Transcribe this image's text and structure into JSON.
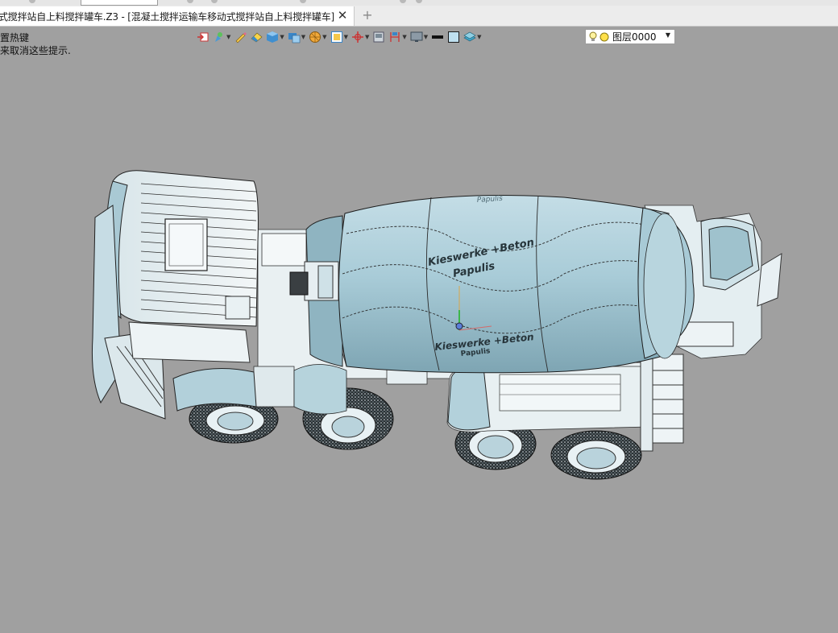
{
  "window": {
    "tab_title": "式搅拌站自上料搅拌罐车.Z3 - [混凝土搅拌运输车移动式搅拌站自上料搅拌罐车]",
    "tab_close_icon": "close-icon",
    "new_tab_icon": "plus-icon"
  },
  "hints": {
    "line1": "置热键",
    "line2": "来取消这些提示."
  },
  "toolbar": {
    "icons": [
      "insert-icon",
      "pen-icon",
      "pencil-icon",
      "eraser-icon",
      "cube-icon",
      "view-cube-icon",
      "sphere-icon",
      "zoom-window-icon",
      "axis-icon",
      "section-icon",
      "dimension-icon",
      "monitor-icon",
      "line-color-icon",
      "fill-color-icon",
      "layer-stack-icon"
    ],
    "layer_select": {
      "value": "图层0000",
      "icons": [
        "bulb-icon",
        "layer-color-icon"
      ]
    }
  },
  "model": {
    "drum_text_top": "Kieswerke +Beton",
    "drum_text_top_sub": "Papulis",
    "drum_text_bottom": "Kieswerke +Beton",
    "drum_text_bottom_sub": "Papulis",
    "drum_text_faint": "Papulis",
    "colors": {
      "body": "#a9ccd8",
      "body_dark": "#6c8f9c",
      "cab_white": "#eef3f5",
      "tire": "#2f3538",
      "background": "#a0a0a0"
    }
  }
}
